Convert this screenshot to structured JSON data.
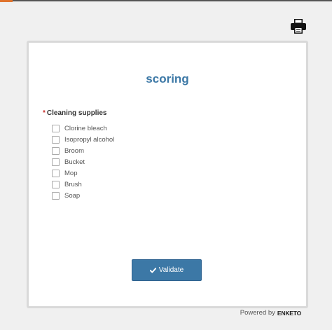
{
  "icons": {
    "print": "printer-icon",
    "check": "check-icon"
  },
  "colors": {
    "accent": "#3c78a6",
    "required": "#c9302c",
    "top_bar_accent": "#e0732c"
  },
  "form": {
    "title": "scoring",
    "question": {
      "required_mark": "*",
      "label": "Cleaning supplies",
      "options": [
        {
          "label": "Clorine bleach",
          "checked": false
        },
        {
          "label": "Isopropyl alcohol",
          "checked": false
        },
        {
          "label": "Broom",
          "checked": false
        },
        {
          "label": "Bucket",
          "checked": false
        },
        {
          "label": "Mop",
          "checked": false
        },
        {
          "label": "Brush",
          "checked": false
        },
        {
          "label": "Soap",
          "checked": false
        }
      ]
    },
    "validate_label": "Validate"
  },
  "footer": {
    "powered_by": "Powered by",
    "brand": "ENKETO"
  }
}
